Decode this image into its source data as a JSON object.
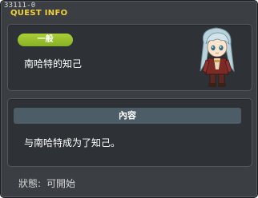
{
  "window": {
    "quest_id": "33111-0",
    "title": "QUEST INFO"
  },
  "quest": {
    "category_tag": "一般",
    "name": "南哈特的知己",
    "npc_portrait_icon": "npc-portrait-icon"
  },
  "content": {
    "section_label": "內容",
    "description": "与南哈特成为了知己。"
  },
  "status": {
    "label": "狀態:",
    "value": "可開始"
  },
  "colors": {
    "title": "#f2d23c",
    "tag": "#9bc42e",
    "panel": "#2e3236",
    "window": "#3b3f44",
    "section_bar": "#4d5d68"
  }
}
